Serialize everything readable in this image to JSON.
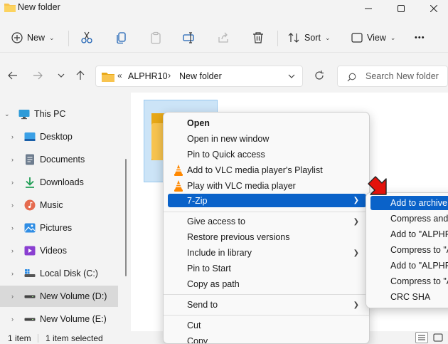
{
  "window": {
    "title": "New folder"
  },
  "commandbar": {
    "new_label": "New",
    "sort_label": "Sort",
    "view_label": "View",
    "more_label": "•••"
  },
  "address": {
    "overflow": "«",
    "crumbs": [
      "ALPHR10",
      "New folder"
    ],
    "separator": "›",
    "search_placeholder": "Search New folder"
  },
  "sidebar": {
    "items": [
      {
        "label": "This PC",
        "icon": "monitor-icon"
      },
      {
        "label": "Desktop",
        "icon": "desktop-icon"
      },
      {
        "label": "Documents",
        "icon": "documents-icon"
      },
      {
        "label": "Downloads",
        "icon": "download-icon"
      },
      {
        "label": "Music",
        "icon": "music-icon"
      },
      {
        "label": "Pictures",
        "icon": "pictures-icon"
      },
      {
        "label": "Videos",
        "icon": "videos-icon"
      },
      {
        "label": "Local Disk (C:)",
        "icon": "drive-icon"
      },
      {
        "label": "New Volume (D:)",
        "icon": "drive-icon",
        "selected": true
      },
      {
        "label": "New Volume (E:)",
        "icon": "drive-icon"
      }
    ]
  },
  "status": {
    "count": "1 item",
    "selected": "1 item selected"
  },
  "context_menu": {
    "open": "Open",
    "open_new_window": "Open in new window",
    "pin_quick_access": "Pin to Quick access",
    "vlc_playlist": "Add to VLC media player's Playlist",
    "vlc_play": "Play with VLC media player",
    "sevenzip": "7-Zip",
    "give_access": "Give access to",
    "restore_versions": "Restore previous versions",
    "include_library": "Include in library",
    "pin_start": "Pin to Start",
    "copy_path": "Copy as path",
    "send_to": "Send to",
    "cut": "Cut",
    "copy": "Copy"
  },
  "sevenzip_menu": {
    "items": [
      "Add to archive...",
      "Compress and email...",
      "Add to \"ALPHR",
      "Compress to \"A",
      "Add to \"ALPHR",
      "Compress to \"A",
      "CRC SHA"
    ]
  },
  "colors": {
    "accent": "#0a62c9",
    "selection": "#cce4f7",
    "folder": "#f8c44f",
    "arrow": "#e3120b"
  }
}
